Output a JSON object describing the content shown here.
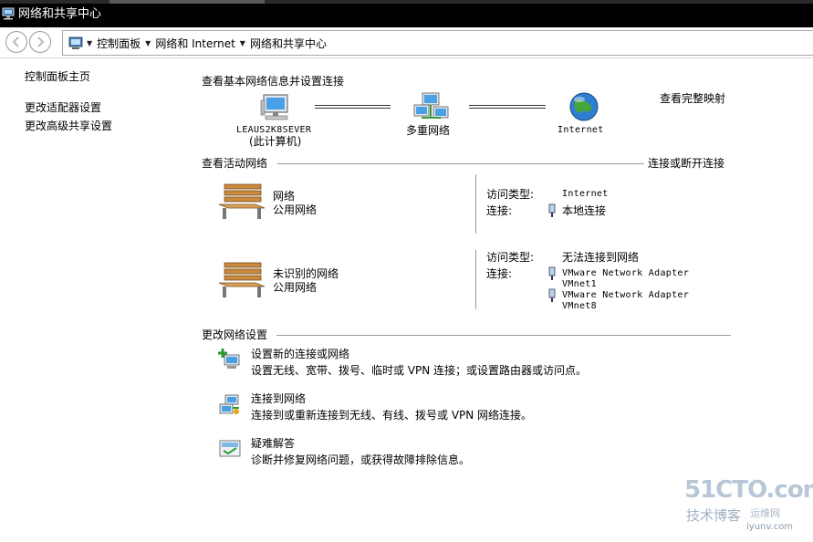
{
  "window": {
    "title": "网络和共享中心"
  },
  "address_bar": {
    "crumbs": [
      "控制面板",
      "网络和 Internet",
      "网络和共享中心"
    ]
  },
  "left_pane": {
    "links": [
      "控制面板主页",
      "更改适配器设置",
      "更改高级共享设置"
    ]
  },
  "basic_info": {
    "heading": "查看基本网络信息并设置连接",
    "full_map_link": "查看完整映射",
    "computer_name": "LEAUS2K8SEVER",
    "computer_sub": "(此计算机)",
    "network_label": "多重网络",
    "internet_label": "Internet"
  },
  "active_networks": {
    "heading": "查看活动网络",
    "connect_link": "连接或断开连接",
    "networks": [
      {
        "name": "网络",
        "type": "公用网络",
        "access_label": "访问类型:",
        "access_value": "Internet",
        "conn_label": "连接:",
        "connections": [
          "本地连接"
        ]
      },
      {
        "name": "未识别的网络",
        "type": "公用网络",
        "access_label": "访问类型:",
        "access_value": "无法连接到网络",
        "conn_label": "连接:",
        "connections": [
          "VMware Network Adapter VMnet1",
          "VMware Network Adapter VMnet8"
        ]
      }
    ]
  },
  "change_settings": {
    "heading": "更改网络设置",
    "tasks": [
      {
        "title": "设置新的连接或网络",
        "desc": "设置无线、宽带、拨号、临时或 VPN 连接；或设置路由器或访问点。",
        "icon": "new-connection-icon"
      },
      {
        "title": "连接到网络",
        "desc": "连接到或重新连接到无线、有线、拨号或 VPN 网络连接。",
        "icon": "connect-network-icon"
      },
      {
        "title": "疑难解答",
        "desc": "诊断并修复网络问题，或获得故障排除信息。",
        "icon": "troubleshoot-icon"
      }
    ]
  },
  "watermark": {
    "logo": "51CTO.com",
    "sub": "技术博客",
    "side": "运维网",
    "url": "iyunv.com"
  },
  "colors": {
    "titlebar_bg": "#000000",
    "titlebar_text": "#ffffff",
    "separator": "#9a9a9a"
  }
}
